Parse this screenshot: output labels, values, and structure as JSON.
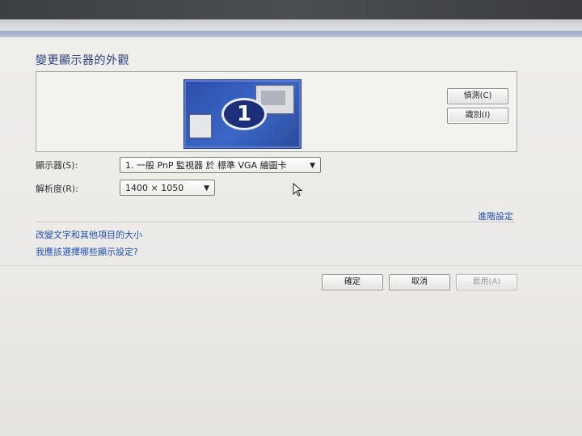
{
  "page": {
    "title": "變更顯示器的外觀"
  },
  "preview": {
    "monitor_number": "1",
    "detect_label": "偵測(C)",
    "identify_label": "識別(I)"
  },
  "settings": {
    "display_label": "顯示器(S):",
    "display_value": "1. 一般 PnP 監視器 於 標準 VGA 繪圖卡",
    "resolution_label": "解析度(R):",
    "resolution_value": "1400 × 1050"
  },
  "links": {
    "advanced": "進階設定",
    "text_size": "改變文字和其他項目的大小",
    "which_settings": "我應該選擇哪些顯示設定?"
  },
  "buttons": {
    "ok": "確定",
    "cancel": "取消",
    "apply": "套用(A)"
  },
  "colors": {
    "title": "#2b3f7c",
    "link": "#1f4fb0",
    "monitor": "#3b67c8"
  }
}
